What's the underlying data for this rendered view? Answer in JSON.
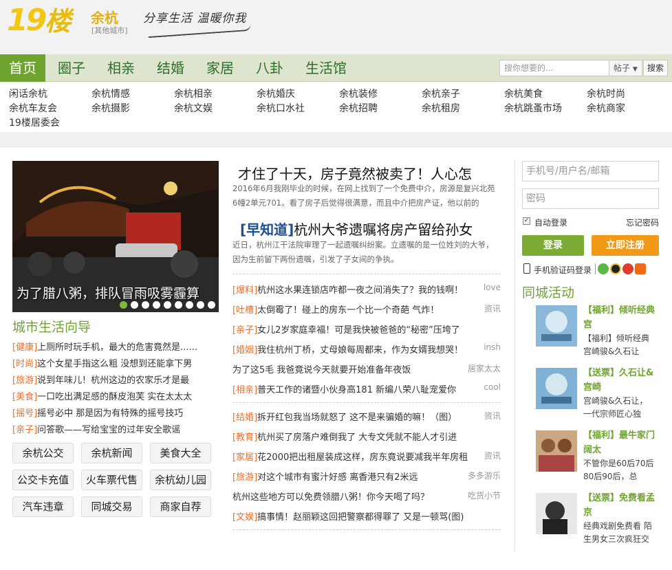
{
  "header": {
    "logo_num": "19",
    "logo_char": "楼",
    "city": "余杭",
    "other_cities": "[其他城市]",
    "slogan": "分享生活 温暖你我"
  },
  "nav": {
    "items": [
      "首页",
      "圈子",
      "相亲",
      "结婚",
      "家居",
      "八卦",
      "生活馆"
    ],
    "search_placeholder": "搜你想要的...",
    "search_type": "帖子",
    "search_button": "搜索"
  },
  "sublinks": [
    "闲话余杭",
    "余杭情感",
    "余杭相亲",
    "余杭婚庆",
    "余杭装修",
    "余杭亲子",
    "余杭美食",
    "余杭时尚",
    "余杭车友会",
    "余杭摄影",
    "余杭文娱",
    "余杭口水社",
    "余杭招聘",
    "余杭租房",
    "余杭跳蚤市场",
    "余杭商家",
    "19楼居委会"
  ],
  "slider": {
    "caption": "为了腊八粥，排队冒雨吸雾霾算",
    "dots": 9,
    "active_dot": 0
  },
  "guide": {
    "title": "城市生活向导",
    "items": [
      {
        "tag": "[健康]",
        "text": "上厕所时玩手机，最大的危害竟然是......"
      },
      {
        "tag": "[时尚]",
        "text": "这个女星手指这么粗 没想到还能拿下男"
      },
      {
        "tag": "[旅游]",
        "text": "说到年味儿！杭州这边的农家乐才是最"
      },
      {
        "tag": "[美食]",
        "text": "一口吃出满足感的酥皮泡芙 实在太太太"
      },
      {
        "tag": "[摇号]",
        "text": "摇号必中 那是因为有特殊的摇号技巧"
      },
      {
        "tag": "[亲子]",
        "text": "问答歌——写给宝宝的过年安全歌谣"
      }
    ],
    "pills": [
      "余杭公交",
      "余杭新闻",
      "美食大全",
      "公交卡充值",
      "火车票代售",
      "余杭幼儿园",
      "汽车违章",
      "同城交易",
      "商家自荐"
    ]
  },
  "feed": {
    "headline1": "才住了十天，房子竟然被卖了！人心怎",
    "summary1": "2016年6月我刚毕业的时候，在网上找到了一个免费中介，房源是复兴北苑6幢2单元701。看了房子后觉得很满意，而且中介把房产证，他以前的",
    "headline2_kw": "[早知道]",
    "headline2": "杭州大爷遗嘱将房产留给孙女",
    "summary2": "近日，杭州江干法院审理了一起遗嘱纠纷案。立遗嘱的是一位姓刘的大爷，因为生前留下两份遗嘱，引发了子女间的争执。",
    "group1": [
      {
        "tag": "[爆料]",
        "text": "杭州这水果连锁店咋都一夜之间消失了？我的钱啊！",
        "src": "love"
      },
      {
        "tag": "[吐槽]",
        "text": "太倒霉了！碰上的房东一个比一个奇葩 气炸！",
        "src": "资讯"
      },
      {
        "tag": "[亲子]",
        "text": "女儿2岁家庭幸福！可是我快被爸爸的“秘密”压垮了",
        "src": ""
      },
      {
        "tag": "[婚姻]",
        "text": "我住杭州丁桥，丈母娘每周都来，作为女婿我想哭！",
        "src": "insh"
      },
      {
        "tag": "",
        "text": "为了这5毛 我爸竟说今天就要开始准备年夜饭",
        "src": "居家太太"
      },
      {
        "tag": "[相亲]",
        "text": "普天工作的诸暨小伙身高181 新编八荣八耻宠爱你",
        "src": "cool"
      }
    ],
    "group2": [
      {
        "tag": "[结婚]",
        "text": "拆开红包我当场就怒了 这不是来骗婚的嘛！（图）",
        "src": "资讯"
      },
      {
        "tag": "[教育]",
        "text": "杭州买了房落户难倒我了 大专文凭就不能人才引进",
        "src": ""
      },
      {
        "tag": "[家居]",
        "text": "花2000把出租屋装成这样，房东竟说要减我半年房租",
        "src": "资讯"
      },
      {
        "tag": "[旅游]",
        "text": "对这个城市有蜜汁好感 离香港只有2米远",
        "src": "多多游乐"
      },
      {
        "tag": "",
        "text": "杭州这些地方可以免费领腊八粥！你今天喝了吗？",
        "src": "吃货小节"
      },
      {
        "tag": "[文娱]",
        "text": "搞事情！赵丽颖这回把警察都得罪了 又是一顿骂(图)",
        "src": ""
      }
    ]
  },
  "login": {
    "username_placeholder": "手机号/用户名/邮箱",
    "password_placeholder": "密码",
    "remember": "自动登录",
    "forgot": "忘记密码",
    "login_button": "登录",
    "register_button": "立即注册",
    "sms_login": "手机验证码登录"
  },
  "activities": {
    "title": "同城活动",
    "items": [
      {
        "title": "【福利】倾听经典 宫",
        "desc": "【福利】倾听经典宫崎骏&久石让"
      },
      {
        "title": "【送票】久石让&宫崎",
        "desc": "宫崎骏&久石让，一代宗师匠心独"
      },
      {
        "title": "【福利】最牛家门阔太",
        "desc": "不管你是60后70后80后90后，总"
      },
      {
        "title": "【送票】免费看孟京",
        "desc": "经典戏剧免费看 陌生男女三次疯狂交"
      }
    ]
  },
  "colors": {
    "brand_green": "#6fa42e",
    "tag_orange": "#e8702a",
    "register_orange": "#f29a18",
    "logo_yellow": "#f0c814"
  }
}
